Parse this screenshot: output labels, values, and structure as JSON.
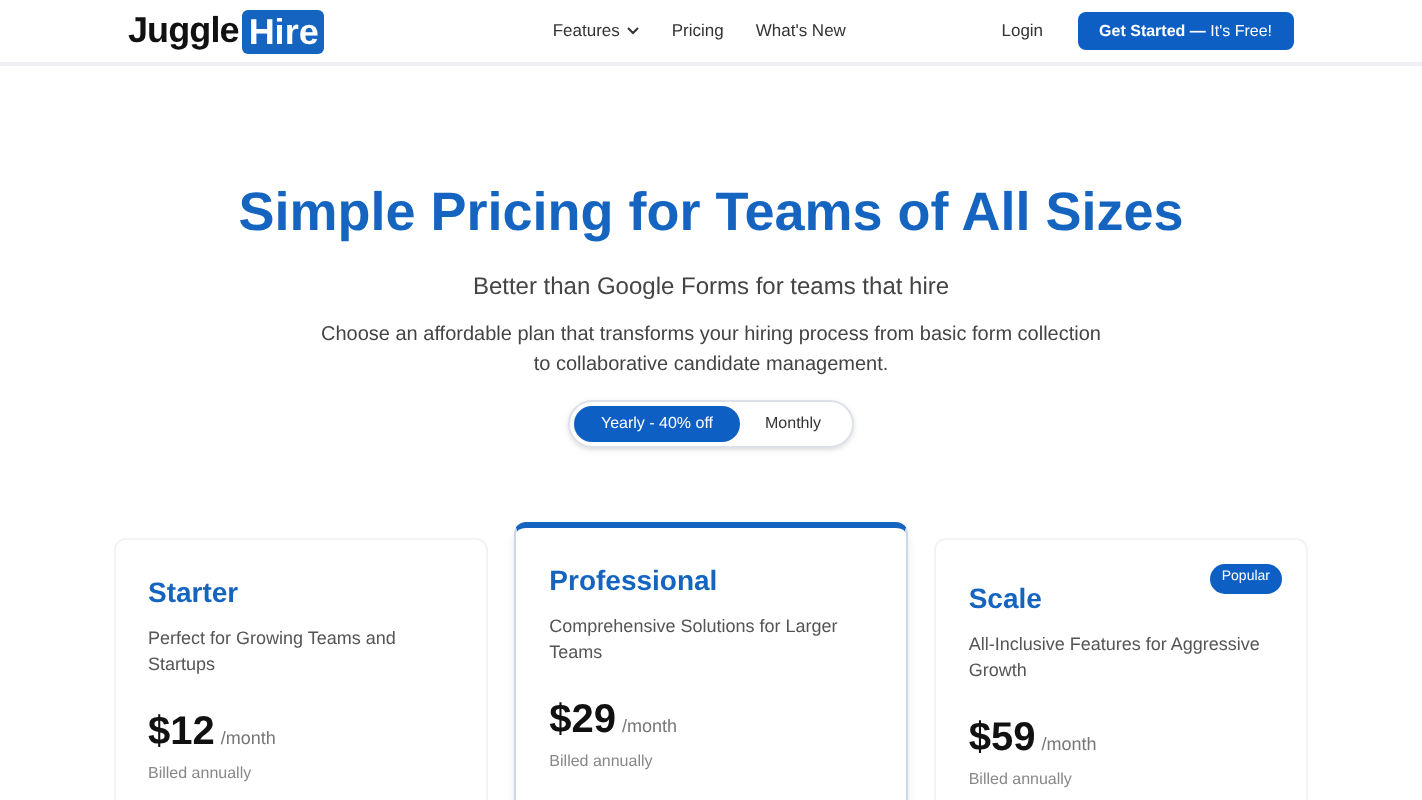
{
  "header": {
    "logo": {
      "word": "Juggle",
      "badge": "Hire"
    },
    "nav": [
      {
        "label": "Features",
        "kind": "dropdown"
      },
      {
        "label": "Pricing",
        "kind": "link"
      },
      {
        "label": "What's New",
        "kind": "link"
      }
    ],
    "login": "Login",
    "cta": {
      "strong": "Get Started —",
      "rest": "It's Free!"
    }
  },
  "hero": {
    "title": "Simple Pricing for Teams of All Sizes",
    "subtitle": "Better than Google Forms for teams that hire",
    "description": "Choose an affordable plan that transforms your hiring process from basic form collection to collaborative candidate management."
  },
  "billing": [
    {
      "label": "Yearly - 40% off",
      "selected": true
    },
    {
      "label": "Monthly",
      "selected": false
    }
  ],
  "plans": [
    {
      "name": "Starter",
      "tagline": "Perfect for Growing Teams and Startups",
      "price": "$12",
      "period": "/month",
      "note": "Billed annually",
      "featured": false
    },
    {
      "name": "Professional",
      "tagline": "Comprehensive Solutions for Larger Teams",
      "price": "$29",
      "period": "/month",
      "note": "Billed annually",
      "featured": true
    },
    {
      "name": "Scale",
      "tagline": "All-Inclusive Features for Aggressive Growth",
      "price": "$59",
      "period": "/month",
      "note": "Billed annually",
      "featured": false,
      "badge": "Popular"
    }
  ]
}
